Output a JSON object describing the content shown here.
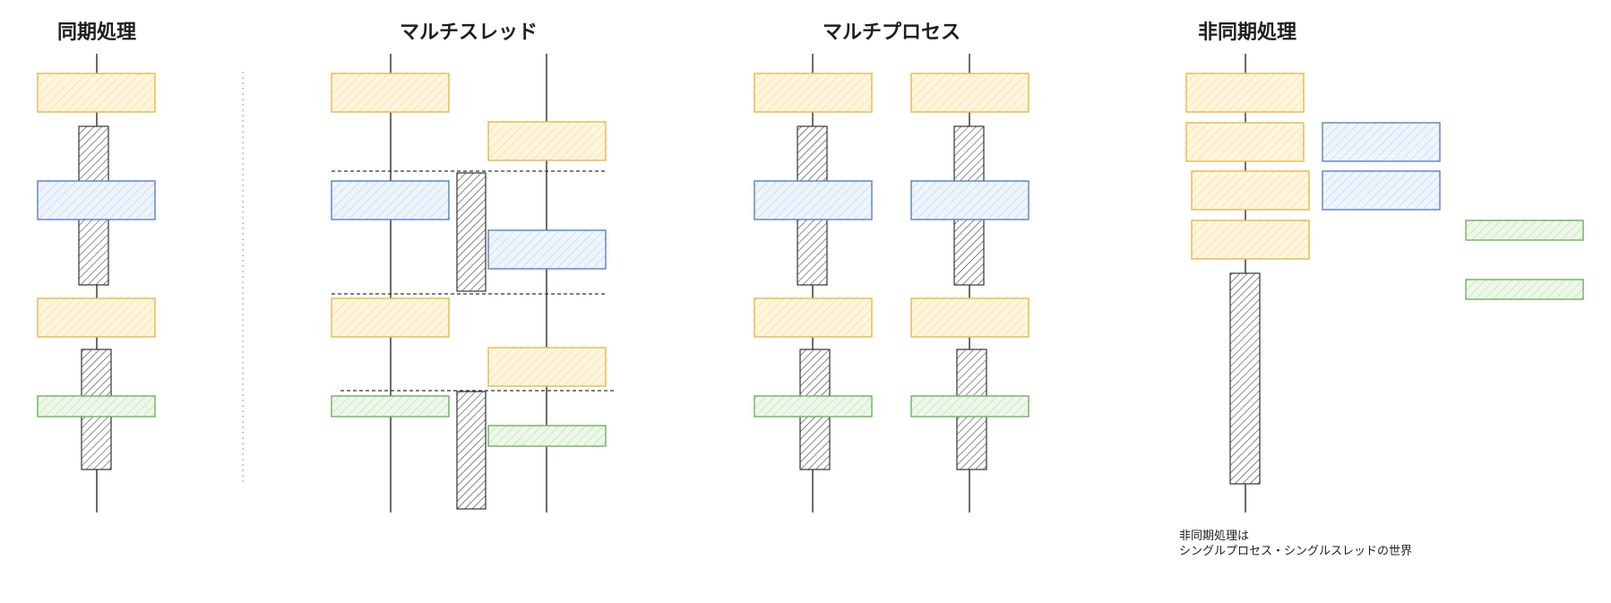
{
  "sections": [
    {
      "id": "sync",
      "title": "同期処理"
    },
    {
      "id": "multithread",
      "title": "マルチスレッド"
    },
    {
      "id": "multiprocess",
      "title": "マルチプロセス"
    },
    {
      "id": "async",
      "title": "非同期処理"
    }
  ],
  "note": {
    "line1": "非同期処理は",
    "line2": "シングルプロセス・シングルスレッドの世界"
  },
  "colors": {
    "yellow_stroke": "#e6b84a",
    "yellow_fill": "#fff6dd",
    "blue_stroke": "#5b80c0",
    "blue_fill": "#e6f0fd",
    "green_stroke": "#6cb35a",
    "green_fill": "#eaf6e4",
    "wait_stroke": "#333333",
    "line": "#1e1e1e"
  }
}
